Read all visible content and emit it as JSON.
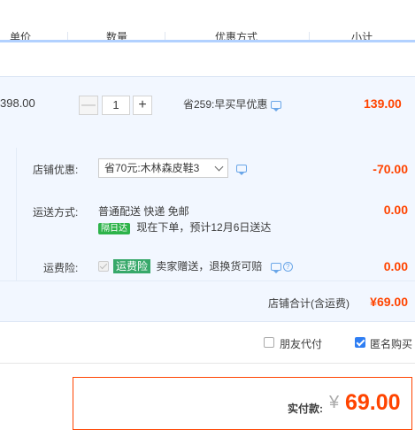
{
  "header": {
    "columns": [
      "单价",
      "数量",
      "优惠方式",
      "小计"
    ]
  },
  "item": {
    "unit_price": "398.00",
    "quantity": "1",
    "minus_label": "—",
    "plus_label": "+",
    "promo_text": "省259:早买早优惠",
    "subtotal": "139.00"
  },
  "options": {
    "shop_discount": {
      "label": "店铺优惠:",
      "selected": "省70元:木林森皮鞋3",
      "amount": "-70.00"
    },
    "delivery": {
      "label": "运送方式:",
      "method": "普通配送 快递 免邮",
      "badge": "隔日达",
      "eta": "现在下单，预计12月6日送达",
      "amount": "0.00"
    },
    "insurance": {
      "label": "运费险:",
      "badge": "运费险",
      "desc": "卖家赠送，退换货可赔",
      "help": "?",
      "amount": "0.00"
    },
    "total_label": "店铺合计(含运费)",
    "total_value": "¥69.00"
  },
  "pay_options": {
    "friend_pay": "朋友代付",
    "anonymous": "匿名购买"
  },
  "summary": {
    "label": "实付款:",
    "currency": "¥",
    "amount": "69.00"
  },
  "colors": {
    "accent_red": "#ff4400",
    "link_blue": "#2f7ef3",
    "header_rule": "#b2d1ff",
    "row_bg": "#f2f7ff"
  }
}
